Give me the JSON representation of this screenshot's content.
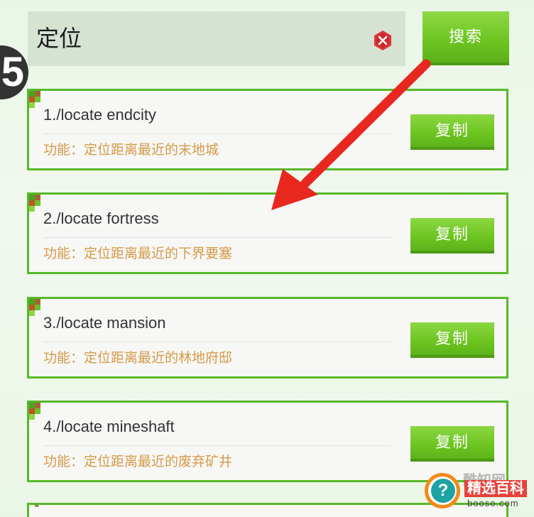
{
  "step_badge": "5",
  "search": {
    "query": "定位",
    "button_label": "搜索"
  },
  "results": [
    {
      "command": "1./locate endcity",
      "description": "功能：定位距离最近的末地城",
      "copy_label": "复制"
    },
    {
      "command": "2./locate fortress",
      "description": "功能：定位距离最近的下界要塞",
      "copy_label": "复制"
    },
    {
      "command": "3./locate mansion",
      "description": "功能：定位距离最近的林地府邸",
      "copy_label": "复制"
    },
    {
      "command": "4./locate mineshaft",
      "description": "功能：定位距离最近的废弃矿井",
      "copy_label": "复制"
    }
  ],
  "watermark": {
    "top_text": "酷知网",
    "title": "精选百科",
    "url": "booso.com"
  },
  "colors": {
    "accent_green": "#6cc420",
    "card_border": "#57b82a",
    "description_text": "#d59a48",
    "arrow_red": "#e8281e",
    "clear_icon_red": "#e0353a"
  }
}
